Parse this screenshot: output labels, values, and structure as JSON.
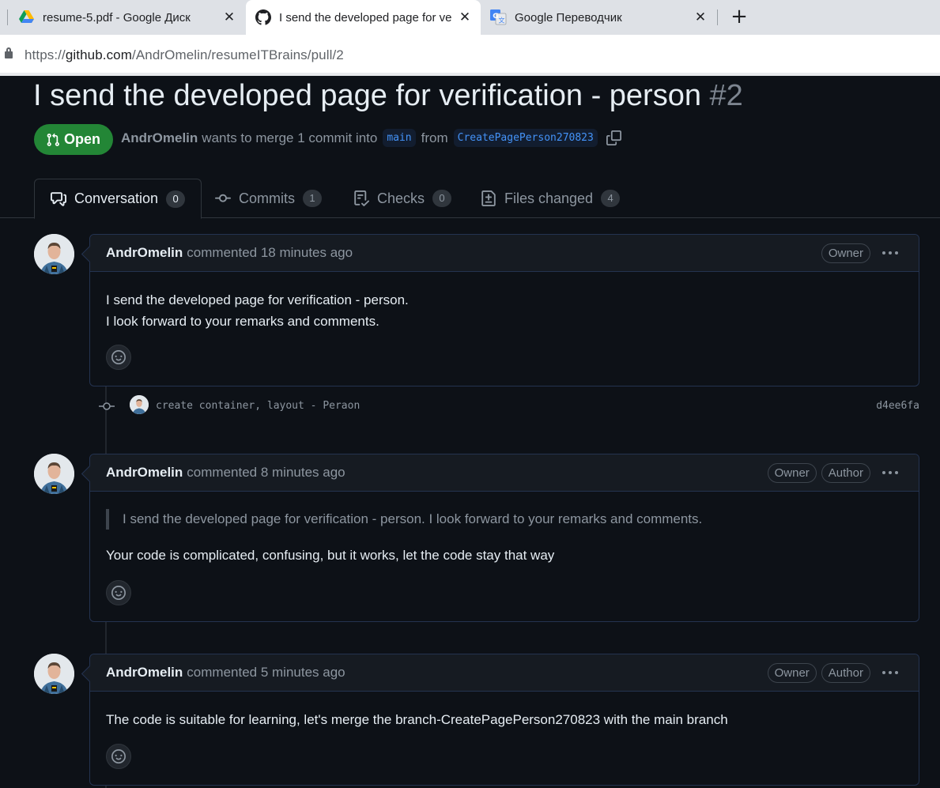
{
  "browser": {
    "tabs": [
      {
        "title": "resume-5.pdf - Google Диск",
        "icon": "google-drive-icon"
      },
      {
        "title": "I send the developed page for ve",
        "icon": "github-icon"
      },
      {
        "title": "Google Переводчик",
        "icon": "google-translate-icon"
      }
    ],
    "new_tab": "+",
    "close_glyph": "✕",
    "url_scheme": "https://",
    "url_host": "github.com",
    "url_path": "/AndrOmelin/resumeITBrains/pull/2"
  },
  "pr": {
    "title": "I send the developed page for verification - person",
    "number": "#2",
    "state": "Open",
    "author": "AndrOmelin",
    "merge_text": "wants to merge 1 commit into",
    "base_branch": "main",
    "from_text": "from",
    "head_branch": "CreatePagePerson270823"
  },
  "tabs": [
    {
      "label": "Conversation",
      "count": "0",
      "icon": "comment-discussion-icon"
    },
    {
      "label": "Commits",
      "count": "1",
      "icon": "git-commit-icon"
    },
    {
      "label": "Checks",
      "count": "0",
      "icon": "checklist-icon"
    },
    {
      "label": "Files changed",
      "count": "4",
      "icon": "file-diff-icon"
    }
  ],
  "comments": [
    {
      "author": "AndrOmelin",
      "time": "commented 18 minutes ago",
      "labels": [
        "Owner"
      ],
      "lines": [
        "I send the developed page for verification - person.",
        "I look forward to your remarks and comments."
      ]
    },
    {
      "author": "AndrOmelin",
      "time": "commented 8 minutes ago",
      "labels": [
        "Owner",
        "Author"
      ],
      "quote": "I send the developed page for verification - person. I look forward to your remarks and comments.",
      "lines": [
        "Your code is complicated, confusing, but it works, let the code stay that way"
      ]
    },
    {
      "author": "AndrOmelin",
      "time": "commented 5 minutes ago",
      "labels": [
        "Owner",
        "Author"
      ],
      "lines": [
        "The code is suitable for learning, let's merge the branch-CreatePagePerson270823 with the main branch"
      ]
    }
  ],
  "commit": {
    "message": "create container, layout - Peraon",
    "sha": "d4ee6fa"
  },
  "colors": {
    "background": "#0d1117",
    "open_green": "#238636",
    "link_blue": "#4493f8",
    "muted": "#8d96a0",
    "border": "#30363d"
  }
}
